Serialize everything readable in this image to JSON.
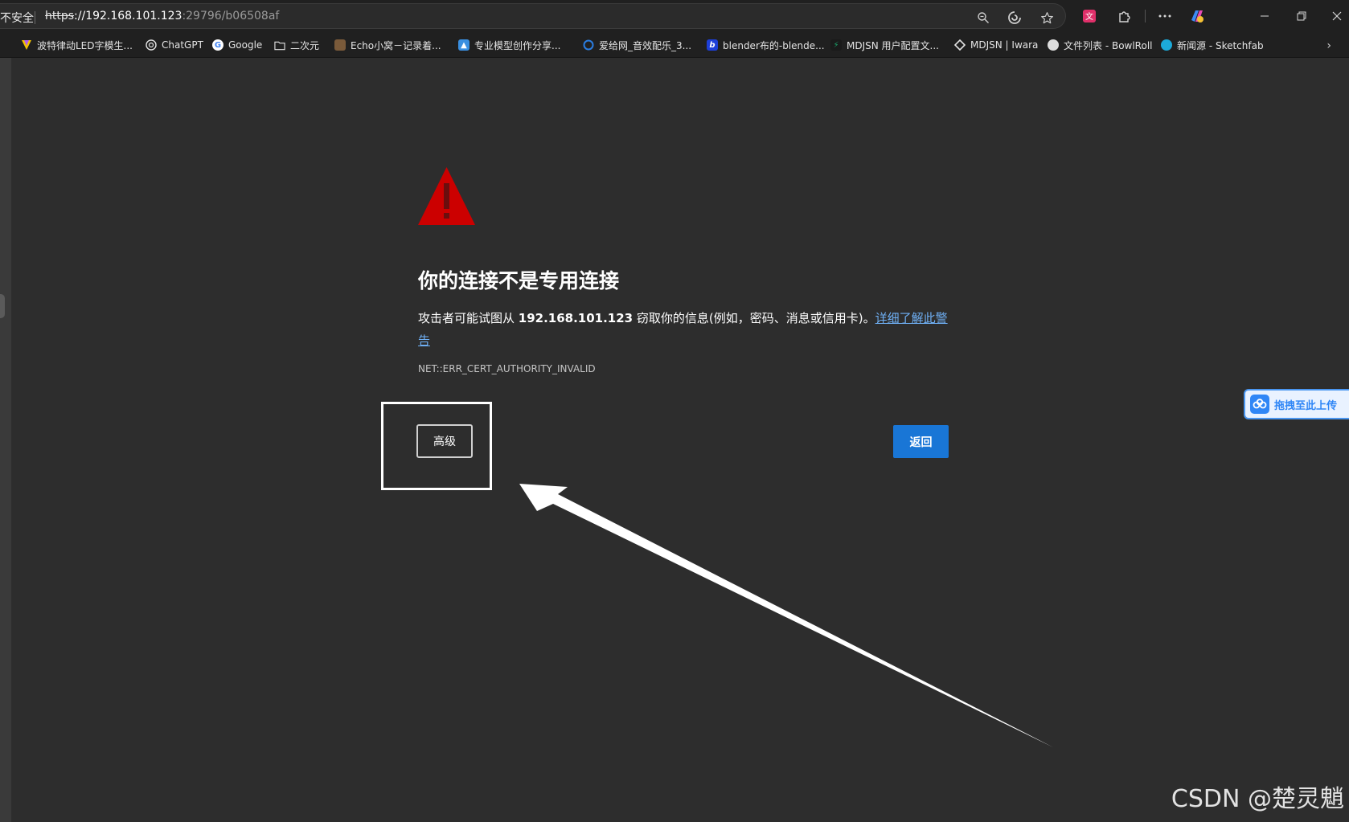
{
  "addressbar": {
    "security_label": "不安全",
    "url_scheme": "https",
    "url_host": "://192.168.101.123",
    "url_path": ":29796/b06508af"
  },
  "bookmarks": [
    {
      "label": "波特律动LED字模生...",
      "icon": "led-font-icon",
      "color": "#f2c200"
    },
    {
      "label": "ChatGPT",
      "icon": "openai-icon",
      "color": "#444444"
    },
    {
      "label": "Google",
      "icon": "google-icon",
      "color": "#ffffff"
    },
    {
      "label": "二次元",
      "icon": "folder-icon",
      "color": "#202020"
    },
    {
      "label": "Echo小窝－记录着...",
      "icon": "echo-avatar-icon",
      "color": "#7a5a3a"
    },
    {
      "label": "专业模型创作分享...",
      "icon": "model-share-icon",
      "color": "#3a8fe0"
    },
    {
      "label": "爱给网_音效配乐_3...",
      "icon": "aigei-icon",
      "color": "#2a7de1"
    },
    {
      "label": "blender布的-blende...",
      "icon": "bilibili-b-icon",
      "color": "#1d3fd8"
    },
    {
      "label": "MDJSN 用户配置文...",
      "icon": "mdjsn-icon",
      "color": "#1aa36a"
    },
    {
      "label": "MDJSN | Iwara",
      "icon": "iwara-icon",
      "color": "#202020"
    },
    {
      "label": "文件列表 - BowlRoll",
      "icon": "circle-icon",
      "color": "#dddddd"
    },
    {
      "label": "新闻源 - Sketchfab",
      "icon": "sketchfab-icon",
      "color": "#1caad9"
    }
  ],
  "error_page": {
    "heading": "你的连接不是专用连接",
    "desc_before": "攻击者可能试图从 ",
    "desc_host": "192.168.101.123",
    "desc_after": " 窃取你的信息(例如，密码、消息或信用卡)。",
    "learn_more": "详细了解此警告",
    "error_code": "NET::ERR_CERT_AUTHORITY_INVALID",
    "advanced_button": "高级",
    "back_button": "返回"
  },
  "upload_widget": {
    "label": "拖拽至此上传"
  },
  "watermark": "CSDN @楚灵魈",
  "colors": {
    "page_bg": "#2d2d2d",
    "chrome_bg": "#202020",
    "warning_red": "#cc0000",
    "back_button_blue": "#1976d6",
    "link_blue": "#6fb0f5"
  }
}
